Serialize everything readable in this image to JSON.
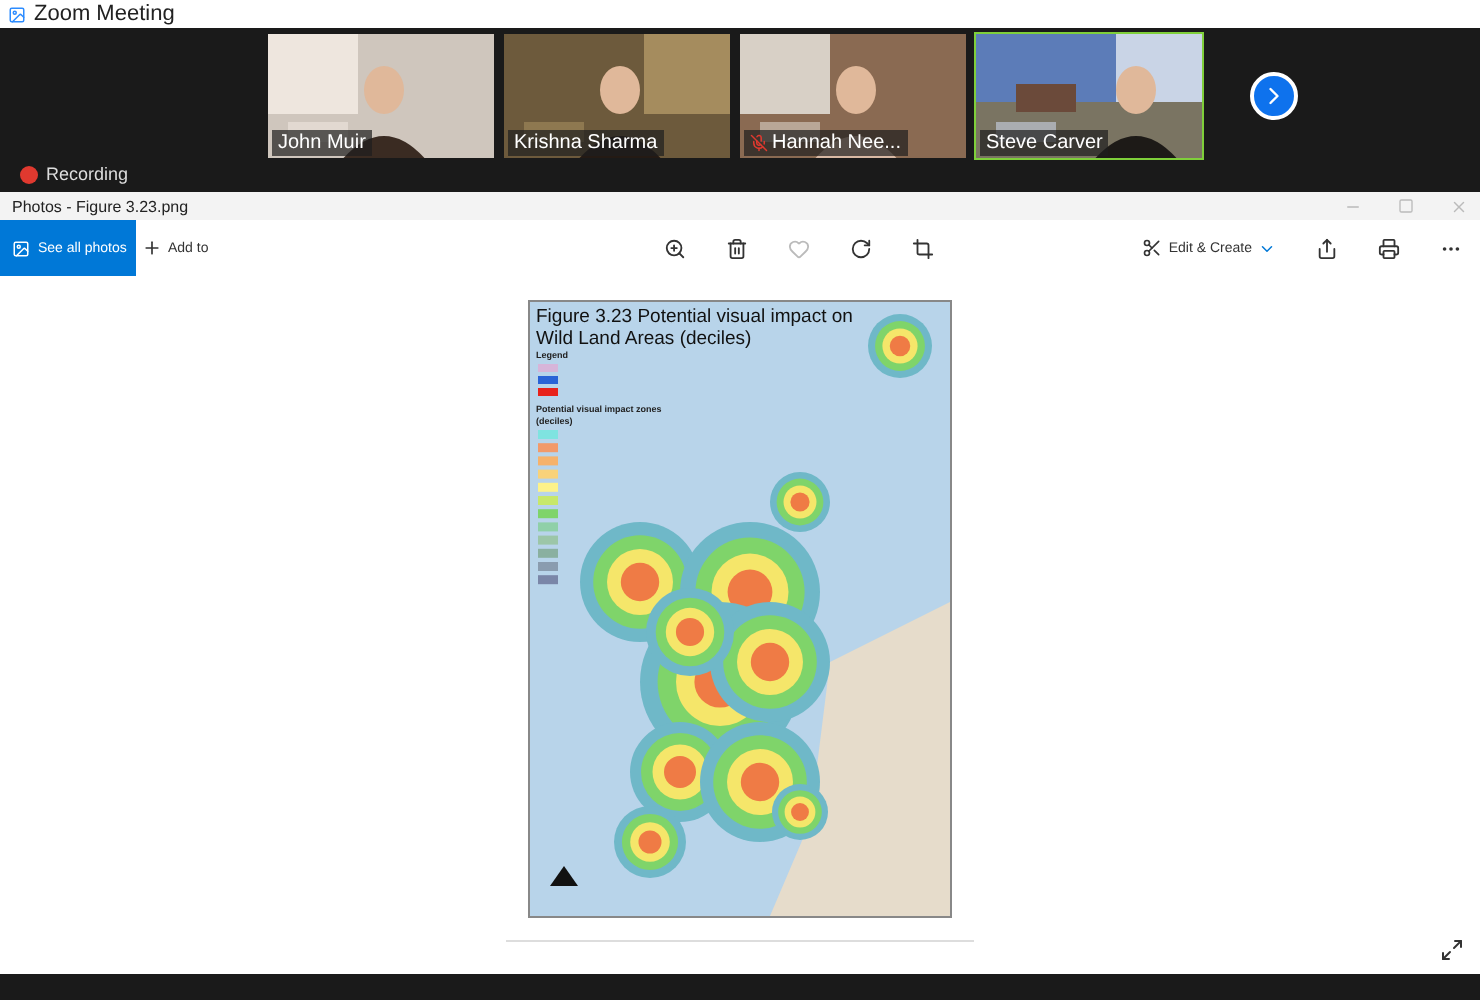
{
  "window": {
    "title": "Zoom Meeting"
  },
  "participants": [
    {
      "name": "John Muir",
      "muted": false,
      "active_speaker": false
    },
    {
      "name": "Krishna Sharma",
      "muted": false,
      "active_speaker": false
    },
    {
      "name": "Hannah Nee...",
      "muted": true,
      "active_speaker": false
    },
    {
      "name": "Steve Carver",
      "muted": false,
      "active_speaker": true
    }
  ],
  "recording": {
    "label": "Recording"
  },
  "photos": {
    "title": "Photos - Figure 3.23.png",
    "toolbar": {
      "see_all": "See all photos",
      "add_to": "Add to",
      "edit_create": "Edit & Create"
    },
    "figure": {
      "title": "Figure 3.23 Potential visual impact on Wild Land Areas (deciles)",
      "legend_title": "Legend",
      "zones_title": "Potential visual impact zones",
      "zones_unit": "(deciles)"
    }
  }
}
